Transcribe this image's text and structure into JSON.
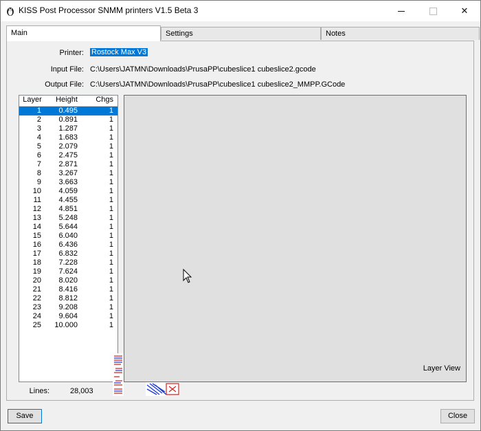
{
  "window": {
    "title": "KISS Post Processor SNMM printers  V1.5 Beta 3"
  },
  "tabs": [
    {
      "label": "Main",
      "active": true
    },
    {
      "label": "Settings",
      "active": false
    },
    {
      "label": "Notes",
      "active": false
    }
  ],
  "fields": {
    "printer_label": "Printer:",
    "printer_value": "Rostock Max V3",
    "input_label": "Input File:",
    "input_value": "C:\\Users\\JATMN\\Downloads\\PrusaPP\\cubeslice1 cubeslice2.gcode",
    "output_label": "Output File:",
    "output_value": "C:\\Users\\JATMN\\Downloads\\PrusaPP\\cubeslice1 cubeslice2_MMPP.GCode"
  },
  "layer_table": {
    "headers": [
      "Layer",
      "Height",
      "Chgs"
    ],
    "rows": [
      [
        "1",
        "0.495",
        "1"
      ],
      [
        "2",
        "0.891",
        "1"
      ],
      [
        "3",
        "1.287",
        "1"
      ],
      [
        "4",
        "1.683",
        "1"
      ],
      [
        "5",
        "2.079",
        "1"
      ],
      [
        "6",
        "2.475",
        "1"
      ],
      [
        "7",
        "2.871",
        "1"
      ],
      [
        "8",
        "3.267",
        "1"
      ],
      [
        "9",
        "3.663",
        "1"
      ],
      [
        "10",
        "4.059",
        "1"
      ],
      [
        "11",
        "4.455",
        "1"
      ],
      [
        "12",
        "4.851",
        "1"
      ],
      [
        "13",
        "5.248",
        "1"
      ],
      [
        "14",
        "5.644",
        "1"
      ],
      [
        "15",
        "6.040",
        "1"
      ],
      [
        "16",
        "6.436",
        "1"
      ],
      [
        "17",
        "6.832",
        "1"
      ],
      [
        "18",
        "7.228",
        "1"
      ],
      [
        "19",
        "7.624",
        "1"
      ],
      [
        "20",
        "8.020",
        "1"
      ],
      [
        "21",
        "8.416",
        "1"
      ],
      [
        "22",
        "8.812",
        "1"
      ],
      [
        "23",
        "9.208",
        "1"
      ],
      [
        "24",
        "9.604",
        "1"
      ],
      [
        "25",
        "10.000",
        "1"
      ]
    ],
    "selected_index": 0
  },
  "layer_view": {
    "label": "Layer View"
  },
  "stats": {
    "lines_label": "Lines:",
    "lines_value": "28,003"
  },
  "buttons": {
    "save": "Save",
    "close": "Close"
  },
  "colors": {
    "selection": "#0078d7",
    "thumb_red": "#d81e1e",
    "thumb_blue": "#1e3cd8"
  }
}
